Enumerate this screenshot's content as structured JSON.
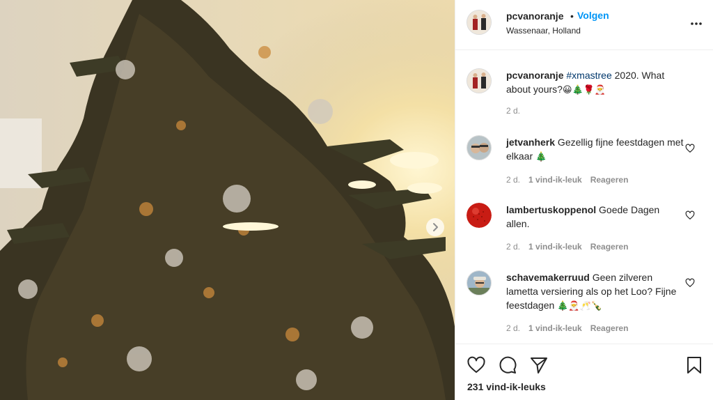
{
  "post": {
    "author": "pcvanoranje",
    "follow_label": "Volgen",
    "follow_separator": "•",
    "location": "Wassenaar, Holland",
    "caption": {
      "username": "pcvanoranje",
      "hashtag": "#xmastree",
      "text": " 2020. What about yours?",
      "emoji": "😀🎄🌹🎅",
      "time": "2 d."
    },
    "likes": "231 vind-ik-leuks"
  },
  "comments": [
    {
      "username": "jetvanherk",
      "text": " Gezellig fijne feestdagen met elkaar ",
      "emoji": "🎄",
      "time": "2 d.",
      "likes": "1 vind-ik-leuk",
      "reply": "Reageren"
    },
    {
      "username": "lambertuskoppenol",
      "text": " Goede Dagen allen.",
      "emoji": "",
      "time": "2 d.",
      "likes": "1 vind-ik-leuk",
      "reply": "Reageren"
    },
    {
      "username": "schavemakerruud",
      "text": " Geen zilveren lametta versiering als op het Loo? Fijne feestdagen ",
      "emoji": "🎄🎅🥂🍾",
      "time": "2 d.",
      "likes": "1 vind-ik-leuk",
      "reply": "Reageren"
    }
  ],
  "icons": {
    "more": "more-options-icon",
    "like": "heart-icon",
    "comment": "comment-icon",
    "share": "paper-plane-icon",
    "save": "bookmark-icon",
    "next": "chevron-right-icon"
  },
  "colors": {
    "accent": "#0095f6",
    "hashtag": "#00376b",
    "muted": "#8e8e8e",
    "border": "#efefef"
  }
}
